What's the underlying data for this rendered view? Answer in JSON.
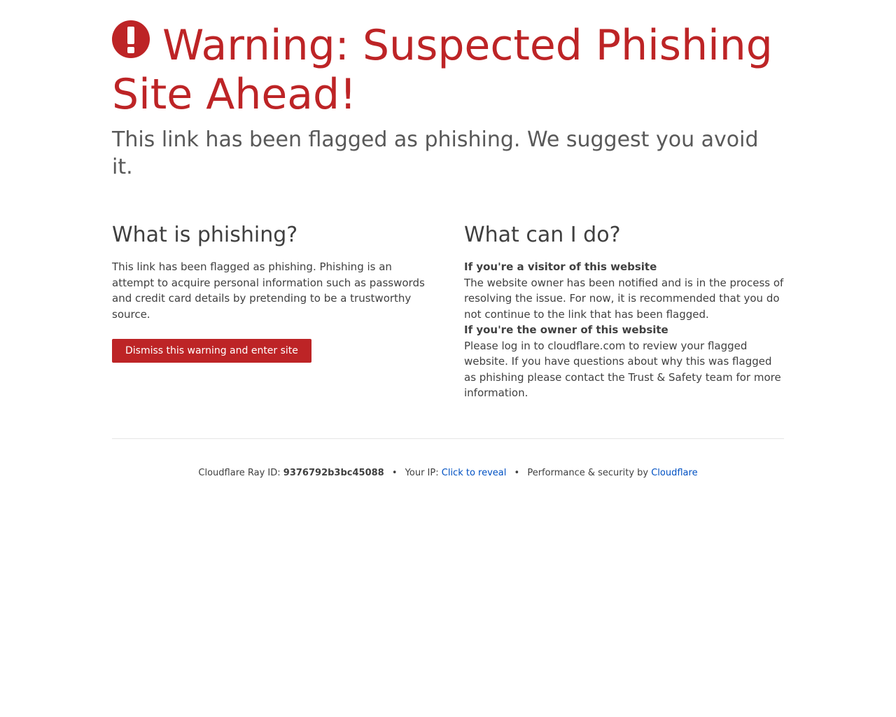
{
  "warning": {
    "icon": "exclamation-circle-icon",
    "title": "Warning: Suspected Phishing Site Ahead!",
    "subtitle": "This link has been flagged as phishing. We suggest you avoid it."
  },
  "what_is_phishing": {
    "heading": "What is phishing?",
    "body": "This link has been flagged as phishing. Phishing is an attempt to acquire personal information such as passwords and credit card details by pretending to be a trustworthy source.",
    "dismiss_button": "Dismiss this warning and enter site"
  },
  "what_can_i_do": {
    "heading": "What can I do?",
    "visitor_heading": "If you're a visitor of this website",
    "visitor_body": "The website owner has been notified and is in the process of resolving the issue. For now, it is recommended that you do not continue to the link that has been flagged.",
    "owner_heading": "If you're the owner of this website",
    "owner_body": "Please log in to cloudflare.com to review your flagged website. If you have questions about why this was flagged as phishing please contact the Trust & Safety team for more information."
  },
  "footer": {
    "ray_label": "Cloudflare Ray ID:",
    "ray_id": "9376792b3bc45088",
    "separator": "•",
    "ip_label": "Your IP:",
    "ip_link": "Click to reveal",
    "perf_label": "Performance & security by",
    "perf_link": "Cloudflare"
  },
  "colors": {
    "accent": "#bd2426",
    "link": "#0051c3",
    "text": "#404040"
  }
}
